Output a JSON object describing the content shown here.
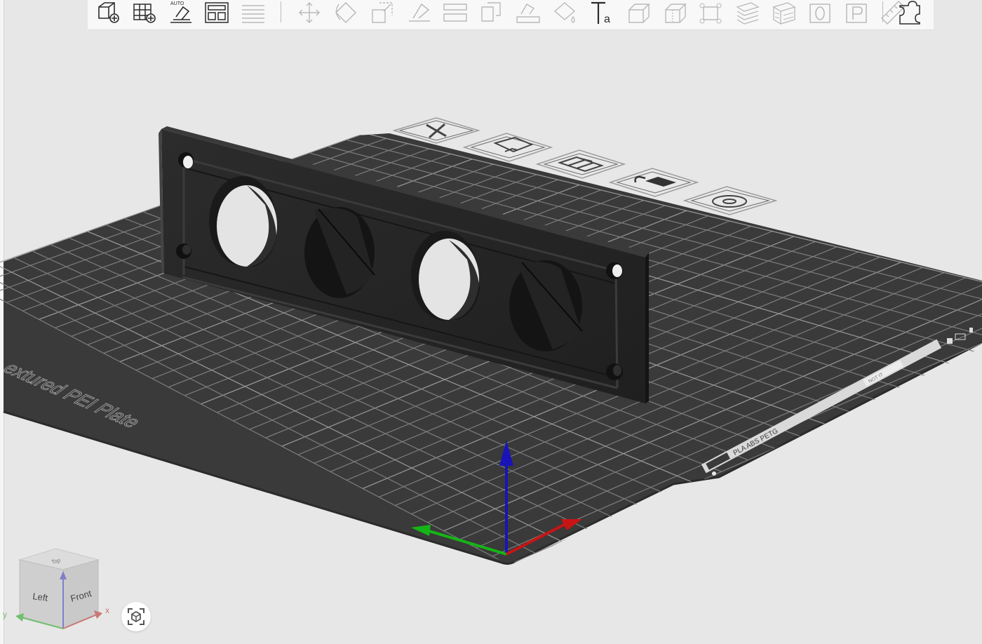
{
  "toolbar": {
    "buttons": [
      {
        "name": "add-object",
        "icon": "cube-plus-icon",
        "enabled": true
      },
      {
        "name": "add-plate",
        "icon": "grid-plus-icon",
        "enabled": true
      },
      {
        "name": "auto-orient",
        "icon": "auto-orient-icon",
        "enabled": true,
        "badge": "AUTO"
      },
      {
        "name": "arrange",
        "icon": "arrange-icon",
        "enabled": true
      },
      {
        "name": "layers",
        "icon": "layers-icon",
        "enabled": false
      },
      {
        "name": "move",
        "icon": "move-icon",
        "enabled": false
      },
      {
        "name": "rotate",
        "icon": "rotate-icon",
        "enabled": false
      },
      {
        "name": "scale",
        "icon": "scale-icon",
        "enabled": false
      },
      {
        "name": "lay-on-face",
        "icon": "lay-on-face-icon",
        "enabled": false
      },
      {
        "name": "split",
        "icon": "split-icon",
        "enabled": false
      },
      {
        "name": "cut",
        "icon": "cut-icon",
        "enabled": false
      },
      {
        "name": "support-paint",
        "icon": "support-paint-icon",
        "enabled": false
      },
      {
        "name": "color-paint",
        "icon": "color-paint-icon",
        "enabled": false
      },
      {
        "name": "text",
        "icon": "text-icon",
        "enabled": true,
        "label": "a"
      },
      {
        "name": "seam-paint",
        "icon": "seam-paint-icon",
        "enabled": false
      },
      {
        "name": "brim-ears",
        "icon": "brim-ears-icon",
        "enabled": false
      },
      {
        "name": "boolean",
        "icon": "boolean-icon",
        "enabled": false
      },
      {
        "name": "variable-layer",
        "icon": "variable-layer-icon",
        "enabled": false
      },
      {
        "name": "fuzzy-skin",
        "icon": "fuzzy-skin-icon",
        "enabled": false
      },
      {
        "name": "mesh-0",
        "icon": "box-o-icon",
        "enabled": false,
        "label": "O"
      },
      {
        "name": "mesh-p",
        "icon": "box-p-icon",
        "enabled": false,
        "label": "P"
      },
      {
        "name": "measure",
        "icon": "ruler-icon",
        "enabled": false
      },
      {
        "name": "assembly",
        "icon": "puzzle-icon",
        "enabled": true
      }
    ]
  },
  "plate": {
    "name_text": "Textured PEI Plate",
    "name_text_visible": "extured PEI Plate",
    "strip_text": "PLA ABS PETG",
    "badge_text": "NOT IT"
  },
  "plate_icons": [
    {
      "name": "delete-plate",
      "icon": "close-icon"
    },
    {
      "name": "plate-import",
      "icon": "import-icon"
    },
    {
      "name": "plate-arrange",
      "icon": "arrange-icon"
    },
    {
      "name": "plate-lock",
      "icon": "lock-icon"
    },
    {
      "name": "plate-settings",
      "icon": "gear-icon"
    }
  ],
  "nav_cube": {
    "face_left": "Left",
    "face_front": "Front",
    "face_top": "Top",
    "axis_x": "x",
    "axis_y": "y"
  },
  "colors": {
    "background": "#e7e7e7",
    "plate": "#3a3b3a",
    "grid_line": "#7a7b7a",
    "model": "#262626",
    "axis_x": "#c81414",
    "axis_y": "#14b414",
    "axis_z": "#1414b4"
  }
}
